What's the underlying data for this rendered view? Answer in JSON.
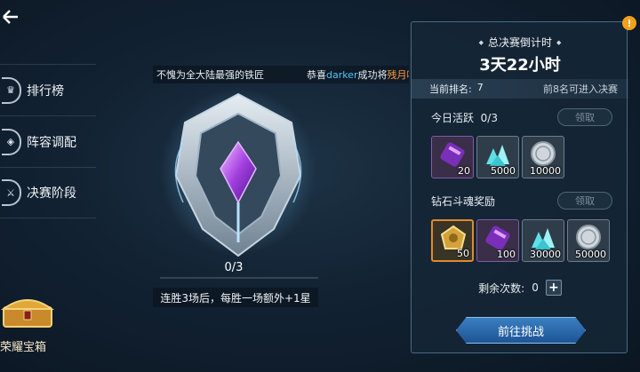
{
  "back": {
    "icon": "back-arrow-icon"
  },
  "side_menu": {
    "items": [
      {
        "label": "排行榜",
        "icon": "trophy-icon"
      },
      {
        "label": "阵容调配",
        "icon": "formation-icon"
      },
      {
        "label": "决赛阶段",
        "icon": "finals-icon"
      }
    ]
  },
  "ticker": {
    "msg1": "不愧为全大陆最强的铁匠",
    "msg2_prefix": "恭喜",
    "msg2_name": "darker",
    "msg2_mid": "成功将",
    "msg2_item": "残月吟戒"
  },
  "emblem": {
    "progress_text": "0/3",
    "progress_fraction": 0.0,
    "tip": "连胜3场后，每胜一场额外+1星"
  },
  "chest": {
    "label": "荣耀宝箱"
  },
  "panel": {
    "info_icon": "!",
    "title": "总决赛倒计时",
    "countdown": "3天22小时",
    "rank_label": "当前排名:",
    "rank_value": "7",
    "rank_note": "前8名可进入决赛",
    "daily": {
      "label": "今日活跃",
      "progress": "0/3",
      "claim": "领取",
      "items": [
        {
          "icon": "purple-scroll-icon",
          "qty": "20"
        },
        {
          "icon": "crystal-shards-icon",
          "qty": "5000"
        },
        {
          "icon": "silver-coin-icon",
          "qty": "10000"
        }
      ]
    },
    "diamond": {
      "label": "钻石斗魂奖励",
      "claim": "领取",
      "items": [
        {
          "icon": "gold-token-icon",
          "qty": "50"
        },
        {
          "icon": "purple-scroll-icon",
          "qty": "100"
        },
        {
          "icon": "crystal-shards-icon",
          "qty": "30000"
        },
        {
          "icon": "silver-coin-icon",
          "qty": "50000"
        }
      ]
    },
    "remaining_label": "剩余次数:",
    "remaining_value": "0",
    "plus": "+",
    "go_button": "前往挑战"
  },
  "colors": {
    "accent_blue": "#4fc3f7",
    "accent_orange": "#ff9a3c",
    "button_blue": "#1d5495"
  }
}
